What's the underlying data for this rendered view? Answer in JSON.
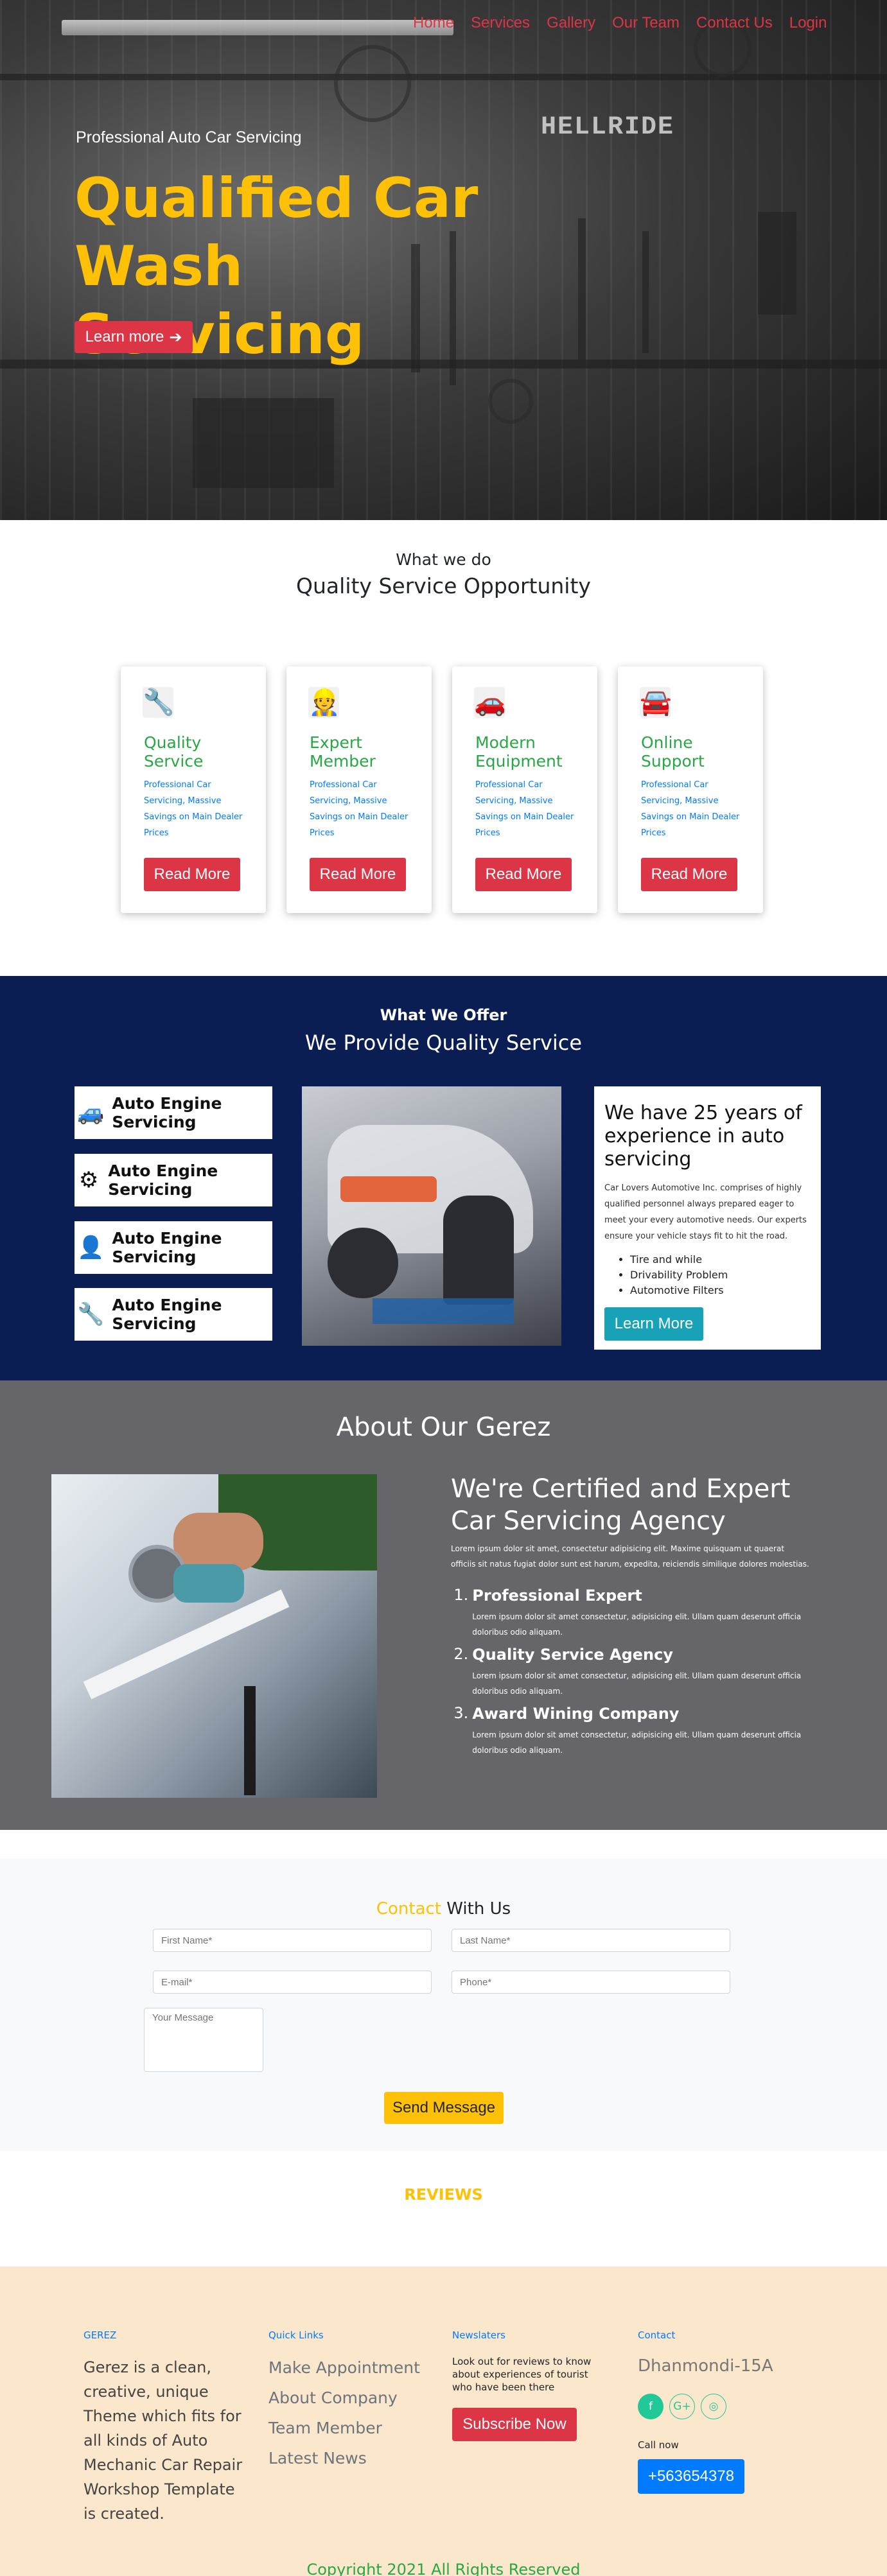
{
  "nav": {
    "items": [
      "Home",
      "Services",
      "Gallery",
      "Our Team",
      "Contact Us",
      "Login"
    ]
  },
  "hero": {
    "subtitle": "Professional Auto Car Servicing",
    "title": "Qualified Car Wash Servicing",
    "button": "Learn more",
    "button_icon": "arrow-right-icon",
    "sign_text": "HELLRIDE"
  },
  "what_we_do": {
    "kicker": "What we do",
    "title": "Quality Service Opportunity",
    "cards": [
      {
        "icon": "car-repair-icon",
        "title": "Quality Service",
        "desc": "Professional Car Servicing, Massive Savings on Main Dealer Prices",
        "button": "Read More"
      },
      {
        "icon": "mechanic-icon",
        "title": "Expert Member",
        "desc": "Professional Car Servicing, Massive Savings on Main Dealer Prices",
        "button": "Read More"
      },
      {
        "icon": "equipment-icon",
        "title": "Modern Equipment",
        "desc": "Professional Car Servicing, Massive Savings on Main Dealer Prices",
        "button": "Read More"
      },
      {
        "icon": "support-icon",
        "title": "Online Support",
        "desc": "Professional Car Servicing, Massive Savings on Main Dealer Prices",
        "button": "Read More"
      }
    ]
  },
  "offer": {
    "kicker": "What We Offer",
    "title": "We Provide Quality Service",
    "items": [
      {
        "icon": "car-wash-icon",
        "label": "Auto Engine Servicing"
      },
      {
        "icon": "gears-icon",
        "label": "Auto Engine Servicing"
      },
      {
        "icon": "user-gear-icon",
        "label": "Auto Engine Servicing"
      },
      {
        "icon": "wrench-icon",
        "label": "Auto Engine Servicing"
      }
    ],
    "card": {
      "title": "We have 25 years of experience in auto servicing",
      "text": "Car Lovers Automotive Inc. comprises of highly qualified personnel always prepared eager to meet your every automotive needs. Our experts ensure your vehicle stays fit to hit the road.",
      "list": [
        "Tire and while",
        "Drivability Problem",
        "Automotive Filters"
      ],
      "button": "Learn More"
    }
  },
  "about": {
    "title": "About Our Gerez",
    "heading": "We're Certified and Expert Car Servicing Agency",
    "text": "Lorem ipsum dolor sit amet, consectetur adipisicing elit. Maxime quisquam ut quaerat officiis sit natus fugiat dolor sunt est harum, expedita, reiciendis similique dolores molestias.",
    "items": [
      {
        "title": "Professional Expert",
        "text": "Lorem ipsum dolor sit amet consectetur, adipisicing elit. Ullam quam deserunt officia doloribus odio aliquam."
      },
      {
        "title": "Quality Service Agency",
        "text": "Lorem ipsum dolor sit amet consectetur, adipisicing elit. Ullam quam deserunt officia doloribus odio aliquam."
      },
      {
        "title": "Award Wining Company",
        "text": "Lorem ipsum dolor sit amet consectetur, adipisicing elit. Ullam quam deserunt officia doloribus odio aliquam."
      }
    ]
  },
  "contact": {
    "title_highlight": "Contact",
    "title_rest": " With Us",
    "first_name_placeholder": "First Name*",
    "last_name_placeholder": "Last Name*",
    "email_placeholder": "E-mail*",
    "phone_placeholder": "Phone*",
    "message_placeholder": "Your Message",
    "button": "Send Message"
  },
  "reviews": {
    "title": "REVIEWS"
  },
  "footer": {
    "brand_head": "GEREZ",
    "brand_text": "Gerez is a clean, creative, unique Theme which fits for all kinds of Auto Mechanic Car Repair Workshop Template is created.",
    "links_head": "Quick Links",
    "links": [
      "Make Appointment",
      "About Company",
      "Team Member",
      "Latest News"
    ],
    "news_head": "Newslaters",
    "news_text": "Look out for reviews to know about experiences of tourist who have been there",
    "subscribe": "Subscribe Now",
    "contact_head": "Contact",
    "address": "Dhanmondi-15A",
    "social": [
      {
        "icon": "facebook-icon",
        "glyph": "f",
        "color": "#20c997"
      },
      {
        "icon": "google-plus-icon",
        "glyph": "G+",
        "color": "#20c997"
      },
      {
        "icon": "instagram-icon",
        "glyph": "◎",
        "color": "#20c997"
      }
    ],
    "call_label": "Call now",
    "phone": "+563654378",
    "copyright": "Copyright 2021 All Rights Reserved"
  },
  "colors": {
    "accent_yellow": "#ffc107",
    "accent_red": "#dc3545",
    "navy": "#0b1e54",
    "about_gray": "#666569",
    "footer_bg": "#fbe7cb"
  }
}
